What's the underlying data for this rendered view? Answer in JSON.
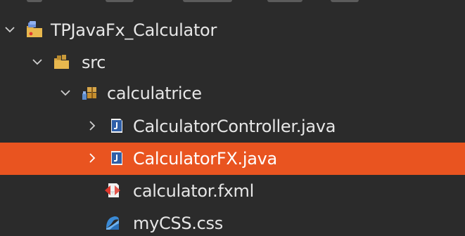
{
  "colors": {
    "background": "#2b2b2b",
    "selection": "#e95420",
    "text": "#e6e6e6"
  },
  "tree": {
    "project": {
      "label": "TPJavaFx_Calculator",
      "icon": "java-project-icon",
      "expanded": true
    },
    "src_folder": {
      "label": "src",
      "icon": "source-folder-icon",
      "expanded": true
    },
    "package": {
      "label": "calculatrice",
      "icon": "package-icon",
      "expanded": true
    },
    "files": [
      {
        "label": "CalculatorController.java",
        "icon": "java-file-icon",
        "expandable": true,
        "selected": false
      },
      {
        "label": "CalculatorFX.java",
        "icon": "java-file-icon",
        "expandable": true,
        "selected": true
      },
      {
        "label": "calculator.fxml",
        "icon": "fxml-file-icon",
        "expandable": false,
        "selected": false
      },
      {
        "label": "myCSS.css",
        "icon": "css-file-icon",
        "expandable": false,
        "selected": false
      }
    ]
  }
}
